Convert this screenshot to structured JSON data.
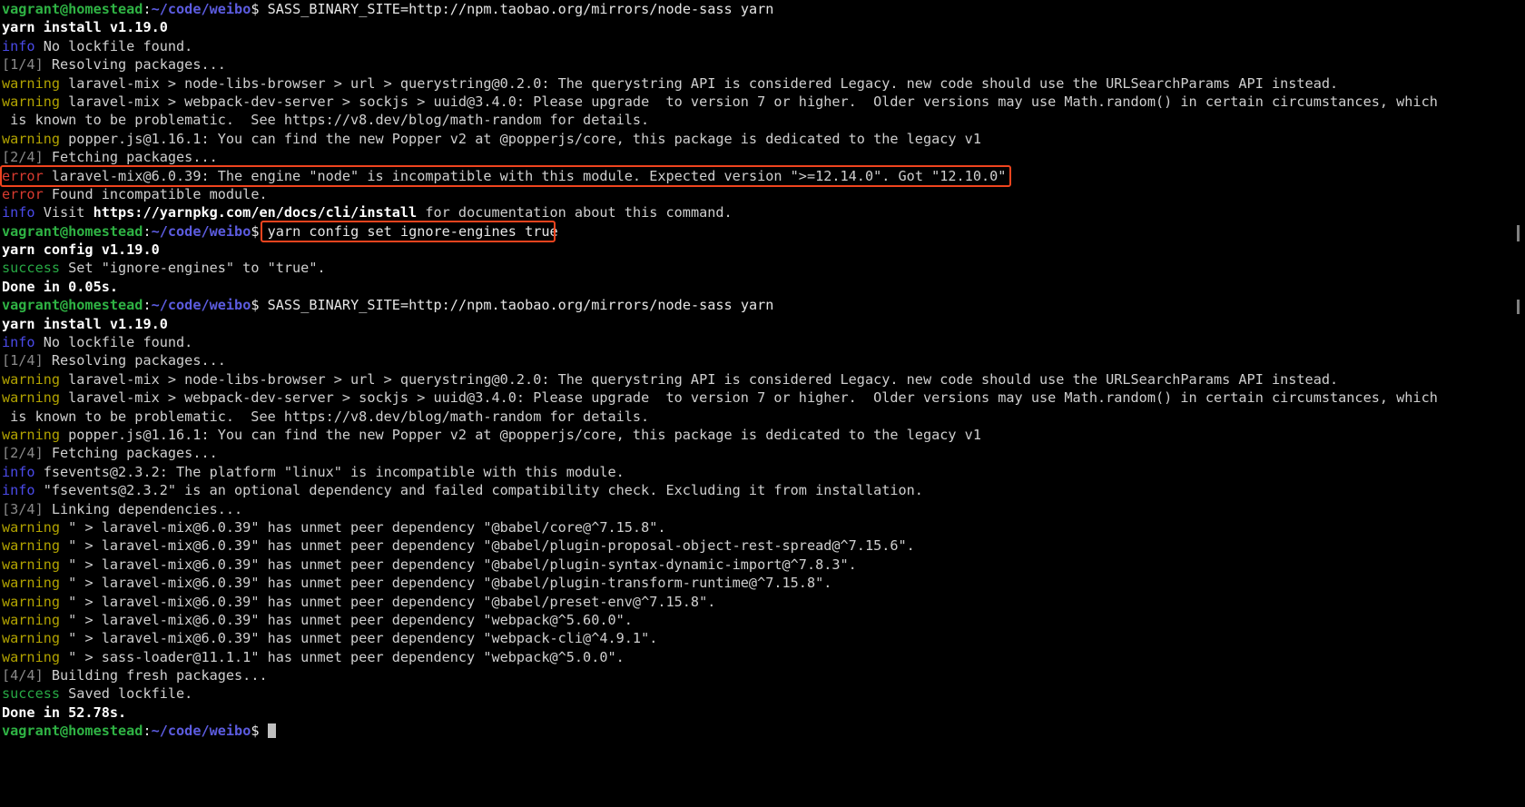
{
  "terminal": {
    "title": "vagrant@homestead: ~/code/weibo",
    "background_color": "#000000",
    "foreground_color": "#d8d8d8",
    "cursor_color": "#bfbfbf",
    "prompt": {
      "user_host": "vagrant@homestead",
      "separator": ":",
      "path": "~/code/weibo",
      "sigil": "$",
      "user_host_color": "#2fb344",
      "path_color": "#5c5ce0"
    },
    "highlights": [
      {
        "name": "error-line-box",
        "color": "#f0441e",
        "target_text": "error laravel-mix@6.0.39: The engine \"node\" is incompatible with this module. Expected version \">=12.14.0\". Got \"12.10.0\""
      },
      {
        "name": "command-box",
        "color": "#f0441e",
        "target_text": "yarn config set ignore-engines true"
      }
    ],
    "lines": [
      {
        "id": "l1",
        "type": "prompt",
        "command": "SASS_BINARY_SITE=http://npm.taobao.org/mirrors/node-sass yarn"
      },
      {
        "id": "l2",
        "type": "bold",
        "text": "yarn install v1.19.0"
      },
      {
        "id": "l3",
        "type": "tagged",
        "tag": "info",
        "tag_class": "c-info",
        "text": "No lockfile found."
      },
      {
        "id": "l4",
        "type": "step",
        "tag": "[1/4]",
        "text": "Resolving packages..."
      },
      {
        "id": "l5",
        "type": "tagged",
        "tag": "warning",
        "tag_class": "c-warning",
        "text": "laravel-mix > node-libs-browser > url > querystring@0.2.0: The querystring API is considered Legacy. new code should use the URLSearchParams API instead."
      },
      {
        "id": "l6",
        "type": "tagged",
        "tag": "warning",
        "tag_class": "c-warning",
        "text": "laravel-mix > webpack-dev-server > sockjs > uuid@3.4.0: Please upgrade  to version 7 or higher.  Older versions may use Math.random() in certain circumstances, which"
      },
      {
        "id": "l7",
        "type": "plain",
        "text": " is known to be problematic.  See https://v8.dev/blog/math-random for details."
      },
      {
        "id": "l8",
        "type": "tagged",
        "tag": "warning",
        "tag_class": "c-warning",
        "text": "popper.js@1.16.1: You can find the new Popper v2 at @popperjs/core, this package is dedicated to the legacy v1"
      },
      {
        "id": "l9",
        "type": "step",
        "tag": "[2/4]",
        "text": "Fetching packages..."
      },
      {
        "id": "l10",
        "type": "tagged",
        "tag": "error",
        "tag_class": "c-error",
        "text": "laravel-mix@6.0.39: The engine \"node\" is incompatible with this module. Expected version \">=12.14.0\". Got \"12.10.0\""
      },
      {
        "id": "l11",
        "type": "tagged",
        "tag": "error",
        "tag_class": "c-error",
        "text": "Found incompatible module."
      },
      {
        "id": "l12",
        "type": "info_link",
        "tag": "info",
        "pre": "Visit ",
        "link": "https://yarnpkg.com/en/docs/cli/install",
        "post": " for documentation about this command."
      },
      {
        "id": "l13",
        "type": "prompt",
        "command": "yarn config set ignore-engines true"
      },
      {
        "id": "l14",
        "type": "bold",
        "text": "yarn config v1.19.0"
      },
      {
        "id": "l15",
        "type": "tagged",
        "tag": "success",
        "tag_class": "c-success",
        "text": "Set \"ignore-engines\" to \"true\"."
      },
      {
        "id": "l16",
        "type": "bold",
        "text": "Done in 0.05s."
      },
      {
        "id": "l17",
        "type": "prompt",
        "command": "SASS_BINARY_SITE=http://npm.taobao.org/mirrors/node-sass yarn"
      },
      {
        "id": "l18",
        "type": "bold",
        "text": "yarn install v1.19.0"
      },
      {
        "id": "l19",
        "type": "tagged",
        "tag": "info",
        "tag_class": "c-info",
        "text": "No lockfile found."
      },
      {
        "id": "l20",
        "type": "step",
        "tag": "[1/4]",
        "text": "Resolving packages..."
      },
      {
        "id": "l21",
        "type": "tagged",
        "tag": "warning",
        "tag_class": "c-warning",
        "text": "laravel-mix > node-libs-browser > url > querystring@0.2.0: The querystring API is considered Legacy. new code should use the URLSearchParams API instead."
      },
      {
        "id": "l22",
        "type": "tagged",
        "tag": "warning",
        "tag_class": "c-warning",
        "text": "laravel-mix > webpack-dev-server > sockjs > uuid@3.4.0: Please upgrade  to version 7 or higher.  Older versions may use Math.random() in certain circumstances, which"
      },
      {
        "id": "l23",
        "type": "plain",
        "text": " is known to be problematic.  See https://v8.dev/blog/math-random for details."
      },
      {
        "id": "l24",
        "type": "tagged",
        "tag": "warning",
        "tag_class": "c-warning",
        "text": "popper.js@1.16.1: You can find the new Popper v2 at @popperjs/core, this package is dedicated to the legacy v1"
      },
      {
        "id": "l25",
        "type": "step",
        "tag": "[2/4]",
        "text": "Fetching packages..."
      },
      {
        "id": "l26",
        "type": "tagged",
        "tag": "info",
        "tag_class": "c-info",
        "text": "fsevents@2.3.2: The platform \"linux\" is incompatible with this module."
      },
      {
        "id": "l27",
        "type": "tagged",
        "tag": "info",
        "tag_class": "c-info",
        "text": "\"fsevents@2.3.2\" is an optional dependency and failed compatibility check. Excluding it from installation."
      },
      {
        "id": "l28",
        "type": "step",
        "tag": "[3/4]",
        "text": "Linking dependencies..."
      },
      {
        "id": "l29",
        "type": "tagged",
        "tag": "warning",
        "tag_class": "c-warning",
        "text": "\" > laravel-mix@6.0.39\" has unmet peer dependency \"@babel/core@^7.15.8\"."
      },
      {
        "id": "l30",
        "type": "tagged",
        "tag": "warning",
        "tag_class": "c-warning",
        "text": "\" > laravel-mix@6.0.39\" has unmet peer dependency \"@babel/plugin-proposal-object-rest-spread@^7.15.6\"."
      },
      {
        "id": "l31",
        "type": "tagged",
        "tag": "warning",
        "tag_class": "c-warning",
        "text": "\" > laravel-mix@6.0.39\" has unmet peer dependency \"@babel/plugin-syntax-dynamic-import@^7.8.3\"."
      },
      {
        "id": "l32",
        "type": "tagged",
        "tag": "warning",
        "tag_class": "c-warning",
        "text": "\" > laravel-mix@6.0.39\" has unmet peer dependency \"@babel/plugin-transform-runtime@^7.15.8\"."
      },
      {
        "id": "l33",
        "type": "tagged",
        "tag": "warning",
        "tag_class": "c-warning",
        "text": "\" > laravel-mix@6.0.39\" has unmet peer dependency \"@babel/preset-env@^7.15.8\"."
      },
      {
        "id": "l34",
        "type": "tagged",
        "tag": "warning",
        "tag_class": "c-warning",
        "text": "\" > laravel-mix@6.0.39\" has unmet peer dependency \"webpack@^5.60.0\"."
      },
      {
        "id": "l35",
        "type": "tagged",
        "tag": "warning",
        "tag_class": "c-warning",
        "text": "\" > laravel-mix@6.0.39\" has unmet peer dependency \"webpack-cli@^4.9.1\"."
      },
      {
        "id": "l36",
        "type": "tagged",
        "tag": "warning",
        "tag_class": "c-warning",
        "text": "\" > sass-loader@11.1.1\" has unmet peer dependency \"webpack@^5.0.0\"."
      },
      {
        "id": "l37",
        "type": "step",
        "tag": "[4/4]",
        "text": "Building fresh packages..."
      },
      {
        "id": "l38",
        "type": "tagged",
        "tag": "success",
        "tag_class": "c-success",
        "text": "Saved lockfile."
      },
      {
        "id": "l39",
        "type": "bold",
        "text": "Done in 52.78s."
      },
      {
        "id": "l40",
        "type": "prompt_cursor",
        "command": ""
      }
    ]
  }
}
